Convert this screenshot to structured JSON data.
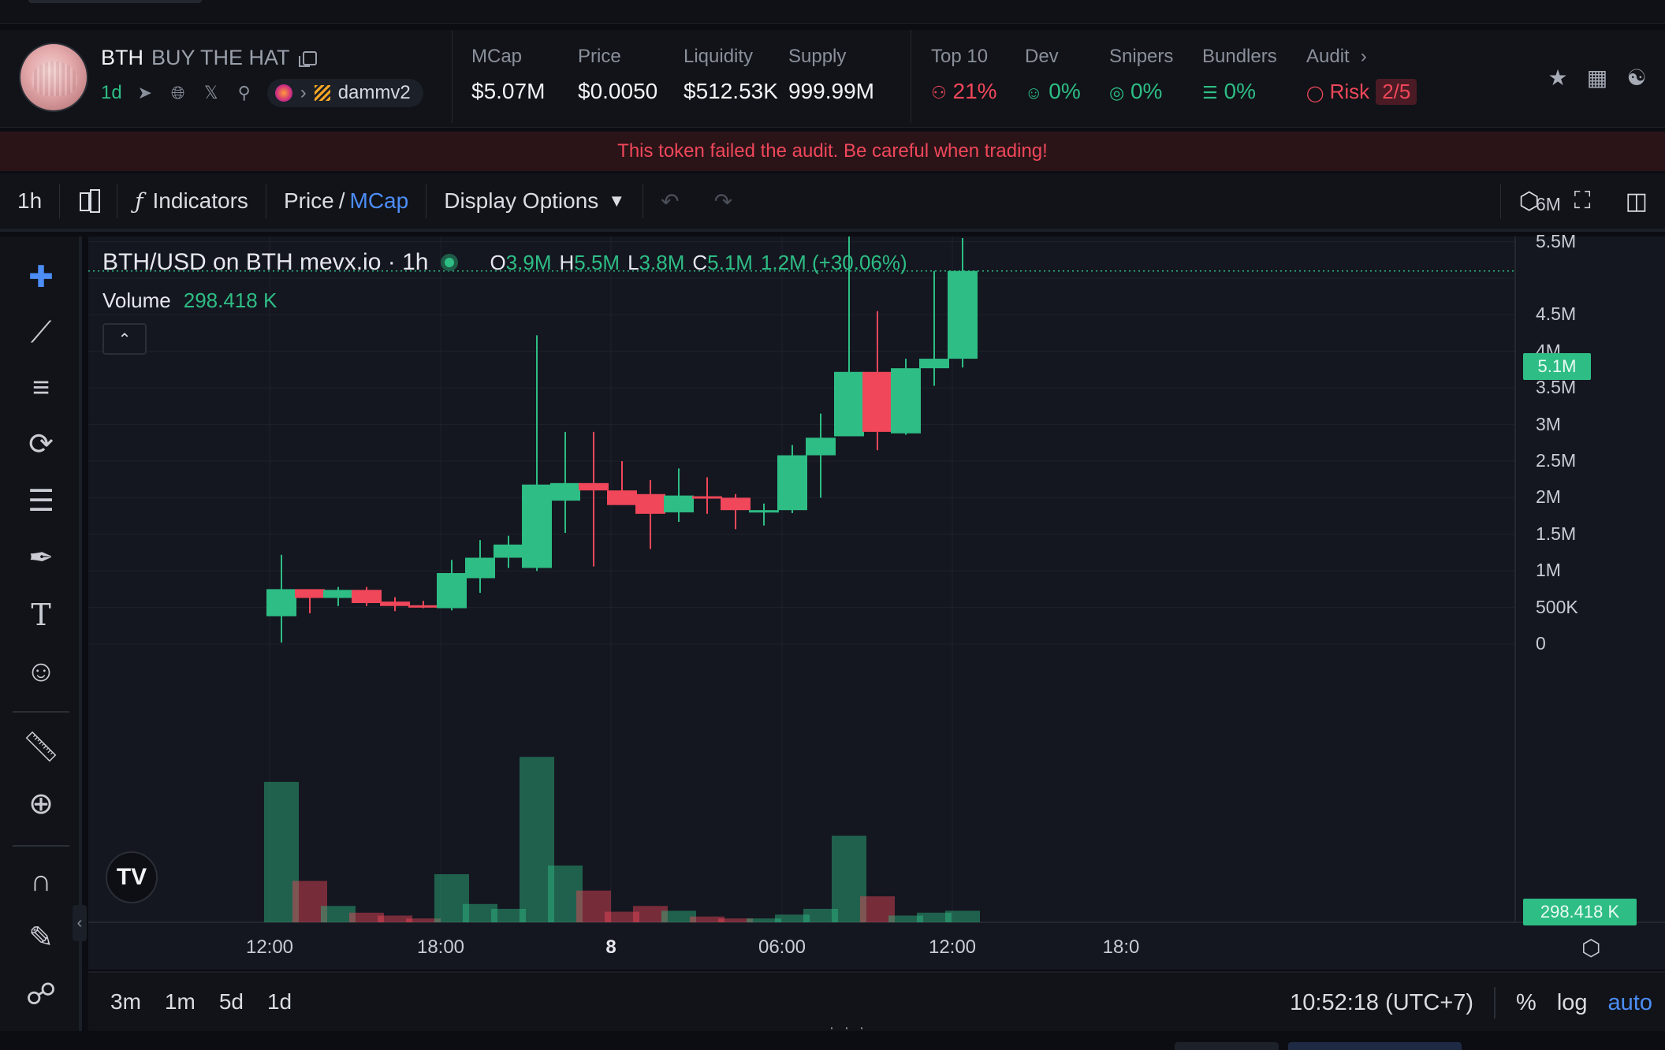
{
  "token": {
    "symbol": "BTH",
    "name": "BUY THE HAT",
    "age": "1d",
    "dex_label": "dammv2"
  },
  "stats": {
    "mcap": {
      "label": "MCap",
      "value": "$5.07M"
    },
    "price": {
      "label": "Price",
      "value": "$0.0050"
    },
    "liquidity": {
      "label": "Liquidity",
      "value": "$512.53K"
    },
    "supply": {
      "label": "Supply",
      "value": "999.99M"
    },
    "top10": {
      "label": "Top 10",
      "value": "21%"
    },
    "dev": {
      "label": "Dev",
      "value": "0%"
    },
    "snipers": {
      "label": "Snipers",
      "value": "0%"
    },
    "bundlers": {
      "label": "Bundlers",
      "value": "0%"
    },
    "audit": {
      "label": "Audit",
      "risk_label": "Risk",
      "risk_value": "2/5"
    }
  },
  "colors": {
    "up": "#2ebd85",
    "down": "#f0475a",
    "accent": "#4c8df6"
  },
  "warning": "This token failed the audit. Be careful when trading!",
  "toolbar": {
    "interval": "1h",
    "indicators": "Indicators",
    "price_label": "Price",
    "slash": "/",
    "mcap_label": "MCap",
    "display_options": "Display Options"
  },
  "legend": {
    "title": "BTH/USD on BTH mevx.io · 1h",
    "o_label": "O",
    "o": "3.9M",
    "h_label": "H",
    "h": "5.5M",
    "l_label": "L",
    "l": "3.8M",
    "c_label": "C",
    "c": "5.1M",
    "change": "1.2M (+30.06%)",
    "volume_label": "Volume",
    "volume_value": "298.418 K"
  },
  "price_tag": "5.1M",
  "volume_tag": "298.418 K",
  "time_display": "10:52:18 (UTC+7)",
  "ranges": [
    "3m",
    "1m",
    "5d",
    "1d"
  ],
  "scale_options": {
    "percent": "%",
    "log": "log",
    "auto": "auto"
  },
  "chart_data": {
    "type": "candlestick",
    "interval": "1h",
    "y_ticks": [
      "6M",
      "5.5M",
      "5.1M",
      "4.5M",
      "4M",
      "3.5M",
      "3M",
      "2.5M",
      "2M",
      "1.5M",
      "1M",
      "500K",
      "0"
    ],
    "x_ticks": [
      "12:00",
      "18:00",
      "8",
      "06:00",
      "12:00",
      "18:0"
    ],
    "ylim": [
      0,
      6.5
    ],
    "y_unit": "M",
    "candles": [
      {
        "o": 0.38,
        "h": 1.22,
        "l": 0.02,
        "c": 0.75
      },
      {
        "o": 0.75,
        "h": 0.75,
        "l": 0.42,
        "c": 0.63
      },
      {
        "o": 0.63,
        "h": 0.78,
        "l": 0.52,
        "c": 0.74
      },
      {
        "o": 0.74,
        "h": 0.78,
        "l": 0.52,
        "c": 0.56
      },
      {
        "o": 0.58,
        "h": 0.64,
        "l": 0.45,
        "c": 0.52
      },
      {
        "o": 0.53,
        "h": 0.59,
        "l": 0.49,
        "c": 0.51
      },
      {
        "o": 0.49,
        "h": 1.15,
        "l": 0.46,
        "c": 0.97
      },
      {
        "o": 0.9,
        "h": 1.42,
        "l": 0.7,
        "c": 1.18
      },
      {
        "o": 1.18,
        "h": 1.48,
        "l": 1.04,
        "c": 1.36
      },
      {
        "o": 1.04,
        "h": 4.22,
        "l": 1.0,
        "c": 2.18
      },
      {
        "o": 1.96,
        "h": 2.9,
        "l": 1.52,
        "c": 2.2
      },
      {
        "o": 2.2,
        "h": 2.9,
        "l": 1.06,
        "c": 2.1
      },
      {
        "o": 2.1,
        "h": 2.5,
        "l": 1.92,
        "c": 1.9
      },
      {
        "o": 2.05,
        "h": 2.24,
        "l": 1.3,
        "c": 1.78
      },
      {
        "o": 1.8,
        "h": 2.4,
        "l": 1.67,
        "c": 2.03
      },
      {
        "o": 2.02,
        "h": 2.28,
        "l": 1.78,
        "c": 2.0
      },
      {
        "o": 2.0,
        "h": 2.05,
        "l": 1.57,
        "c": 1.83
      },
      {
        "o": 1.82,
        "h": 1.92,
        "l": 1.62,
        "c": 1.83
      },
      {
        "o": 1.83,
        "h": 2.72,
        "l": 1.79,
        "c": 2.58
      },
      {
        "o": 2.58,
        "h": 3.15,
        "l": 2.0,
        "c": 2.82
      },
      {
        "o": 2.84,
        "h": 5.7,
        "l": 2.84,
        "c": 3.72
      },
      {
        "o": 3.72,
        "h": 4.55,
        "l": 2.65,
        "c": 2.9
      },
      {
        "o": 2.88,
        "h": 3.9,
        "l": 2.86,
        "c": 3.77
      },
      {
        "o": 3.77,
        "h": 5.1,
        "l": 3.53,
        "c": 3.9
      },
      {
        "o": 3.9,
        "h": 5.55,
        "l": 3.78,
        "c": 5.1
      }
    ],
    "volume": [
      0.146,
      0.043,
      0.017,
      0.01,
      0.007,
      0.004,
      0.05,
      0.019,
      0.014,
      0.172,
      0.059,
      0.033,
      0.011,
      0.017,
      0.012,
      0.006,
      0.004,
      0.004,
      0.008,
      0.014,
      0.09,
      0.027,
      0.007,
      0.01,
      0.012
    ]
  }
}
